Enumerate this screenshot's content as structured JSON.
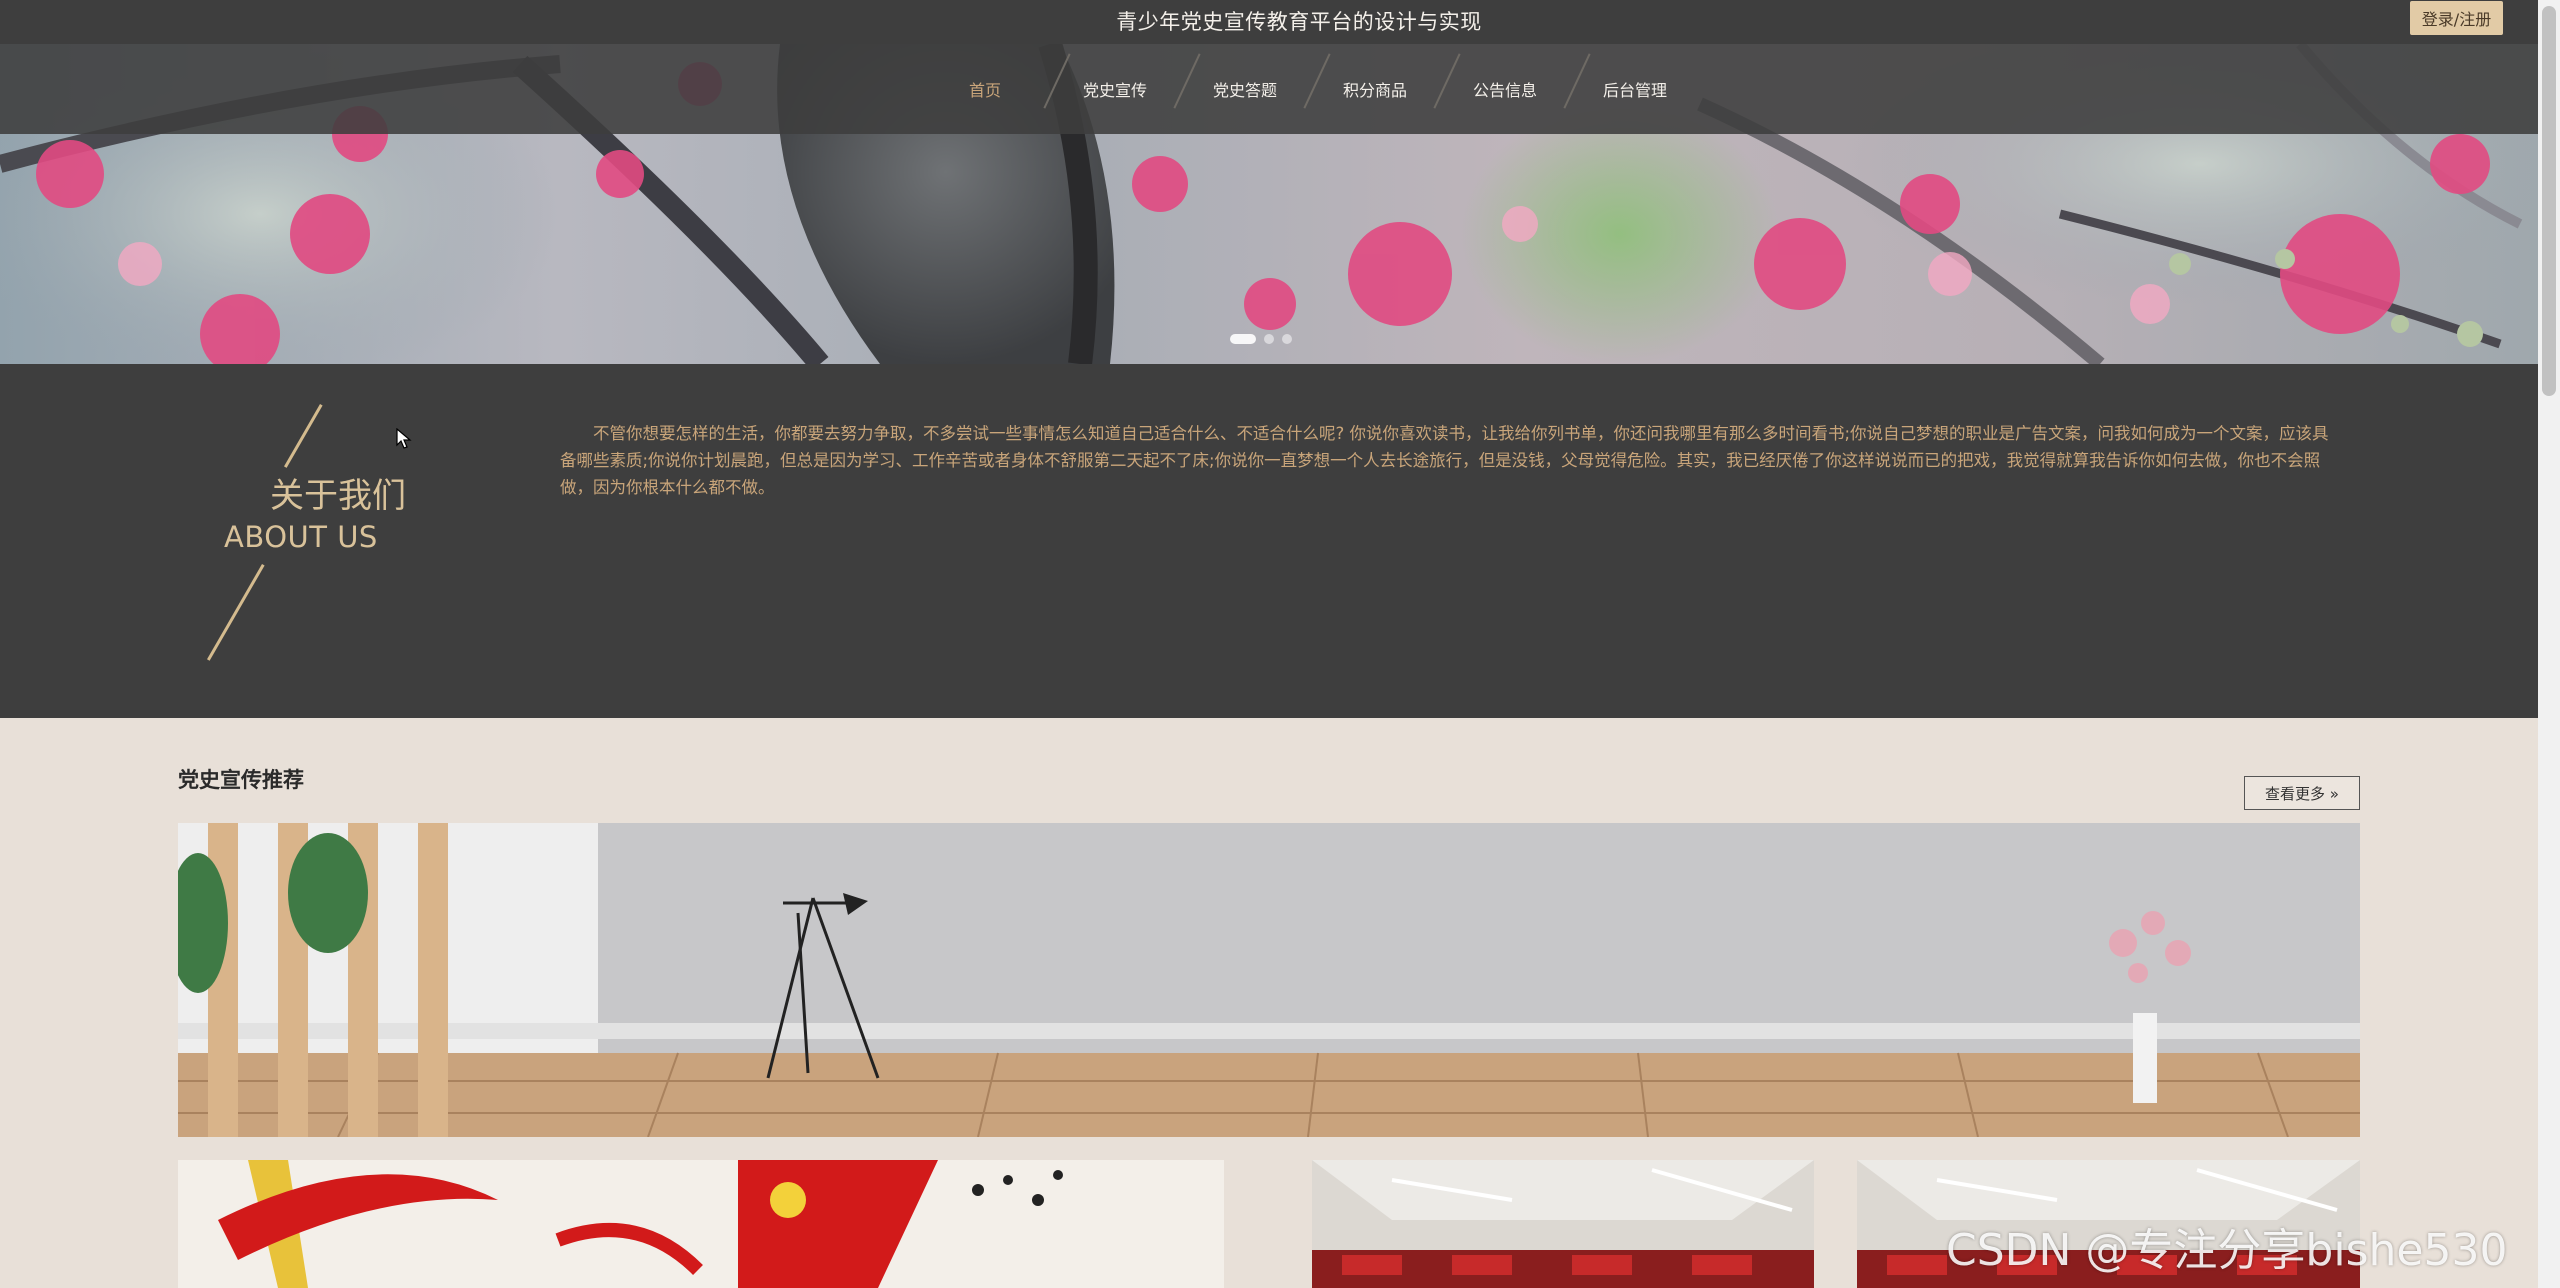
{
  "header": {
    "title": "青少年党史宣传教育平台的设计与实现",
    "login_label": "登录/注册"
  },
  "nav": {
    "items": [
      {
        "label": "首页",
        "active": true
      },
      {
        "label": "党史宣传",
        "active": false
      },
      {
        "label": "党史答题",
        "active": false
      },
      {
        "label": "积分商品",
        "active": false
      },
      {
        "label": "公告信息",
        "active": false
      },
      {
        "label": "后台管理",
        "active": false
      }
    ]
  },
  "banner": {
    "slide_count": 3,
    "active_slide": 1
  },
  "about": {
    "title_cn": "关于我们",
    "title_en": "ABOUT US",
    "text": "不管你想要怎样的生活，你都要去努力争取，不多尝试一些事情怎么知道自己适合什么、不适合什么呢? 你说你喜欢读书，让我给你列书单，你还问我哪里有那么多时间看书;你说自己梦想的职业是广告文案，问我如何成为一个文案，应该具备哪些素质;你说你计划晨跑，但总是因为学习、工作辛苦或者身体不舒服第二天起不了床;你说你一直梦想一个人去长途旅行，但是没钱，父母觉得危险。其实，我已经厌倦了你这样说说而已的把戏，我觉得就算我告诉你如何去做，你也不会照做，因为你根本什么都不做。"
  },
  "section": {
    "title": "党史宣传推荐",
    "more_label": "查看更多 »"
  },
  "watermark": "CSDN @专注分享bishe530",
  "colors": {
    "dark_bg": "#3e3e3e",
    "accent_gold": "#c9a57a",
    "login_bg": "#e2cba6",
    "page_bg": "#e8e0d8"
  }
}
